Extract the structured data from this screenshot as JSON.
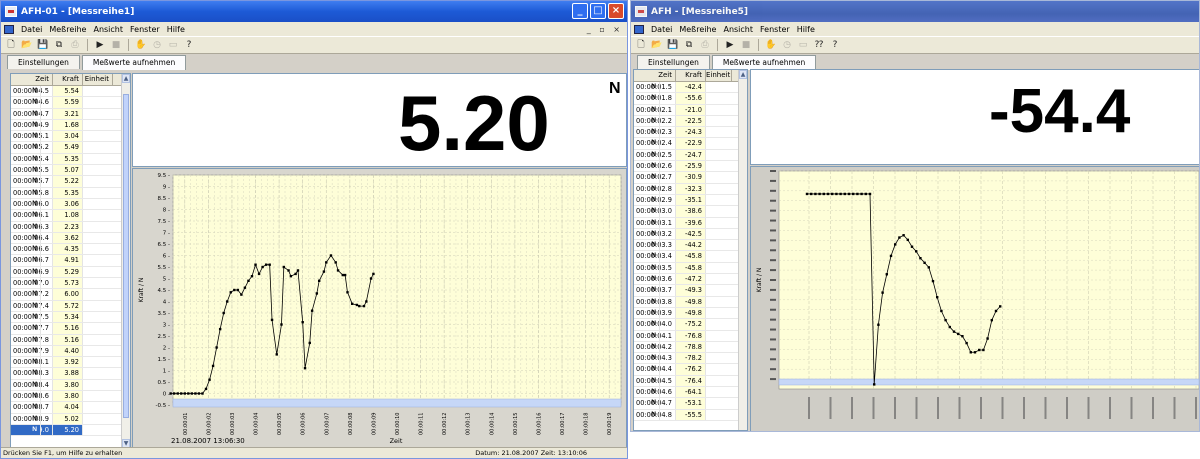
{
  "window_a": {
    "title": "AFH-01 - [Messreihe1]",
    "menu": [
      "Datei",
      "Meßreihe",
      "Ansicht",
      "Fenster",
      "Hilfe"
    ],
    "mdi_controls": "_ ▫ ×",
    "tabs": [
      "Einstellungen",
      "Meßwerte aufnehmen"
    ],
    "active_tab": 1,
    "columns": [
      "Zeit",
      "Kraft",
      "Einheit"
    ],
    "rows": [
      [
        "00:00:04.5",
        "5.54",
        "N"
      ],
      [
        "00:00:04.6",
        "5.59",
        "N"
      ],
      [
        "00:00:04.7",
        "3.21",
        "N"
      ],
      [
        "00:00:04.9",
        "1.68",
        "N"
      ],
      [
        "00:00:05.1",
        "3.04",
        "N"
      ],
      [
        "00:00:05.2",
        "5.49",
        "N"
      ],
      [
        "00:00:05.4",
        "5.35",
        "N"
      ],
      [
        "00:00:05.5",
        "5.07",
        "N"
      ],
      [
        "00:00:05.7",
        "5.22",
        "N"
      ],
      [
        "00:00:05.8",
        "5.35",
        "N"
      ],
      [
        "00:00:06.0",
        "3.06",
        "N"
      ],
      [
        "00:00:06.1",
        "1.08",
        "N"
      ],
      [
        "00:00:06.3",
        "2.23",
        "N"
      ],
      [
        "00:00:06.4",
        "3.62",
        "N"
      ],
      [
        "00:00:06.6",
        "4.35",
        "N"
      ],
      [
        "00:00:06.7",
        "4.91",
        "N"
      ],
      [
        "00:00:06.9",
        "5.29",
        "N"
      ],
      [
        "00:00:07.0",
        "5.73",
        "N"
      ],
      [
        "00:00:07.2",
        "6.00",
        "N"
      ],
      [
        "00:00:07.4",
        "5.72",
        "N"
      ],
      [
        "00:00:07.5",
        "5.34",
        "N"
      ],
      [
        "00:00:07.7",
        "5.16",
        "N"
      ],
      [
        "00:00:07.8",
        "5.16",
        "N"
      ],
      [
        "00:00:07.9",
        "4.40",
        "N"
      ],
      [
        "00:00:08.1",
        "3.92",
        "N"
      ],
      [
        "00:00:08.3",
        "3.88",
        "N"
      ],
      [
        "00:00:08.4",
        "3.80",
        "N"
      ],
      [
        "00:00:08.6",
        "3.80",
        "N"
      ],
      [
        "00:00:08.7",
        "4.04",
        "N"
      ],
      [
        "00:00:08.9",
        "5.02",
        "N"
      ],
      [
        "00:00:09.0",
        "5.20",
        "N"
      ]
    ],
    "selected_row": 30,
    "big_value": "5.20",
    "unit": "N",
    "ylabel": "Kraft / N",
    "xlabel": "Zeit",
    "timestamp": "21.08.2007  13:06:30",
    "status_left": "Drücken Sie F1, um Hilfe zu erhalten",
    "status_right": "Datum: 21.08.2007   Zeit: 13:10:06"
  },
  "window_b": {
    "title": "AFH - [Messreihe5]",
    "menu": [
      "Datei",
      "Meßreihe",
      "Ansicht",
      "Fenster",
      "Hilfe"
    ],
    "tabs": [
      "Einstellungen",
      "Meßwerte aufnehmen"
    ],
    "columns": [
      "Zeit",
      "Kraft",
      "Einheit"
    ],
    "rows": [
      [
        "00:00:01.5",
        "-42.4",
        "N"
      ],
      [
        "00:00:01.8",
        "-55.6",
        "N"
      ],
      [
        "00:00:02.1",
        "-21.0",
        "N"
      ],
      [
        "00:00:02.2",
        "-22.5",
        "N"
      ],
      [
        "00:00:02.3",
        "-24.3",
        "N"
      ],
      [
        "00:00:02.4",
        "-22.9",
        "N"
      ],
      [
        "00:00:02.5",
        "-24.7",
        "N"
      ],
      [
        "00:00:02.6",
        "-25.9",
        "N"
      ],
      [
        "00:00:02.7",
        "-30.9",
        "N"
      ],
      [
        "00:00:02.8",
        "-32.3",
        "N"
      ],
      [
        "00:00:02.9",
        "-35.1",
        "N"
      ],
      [
        "00:00:03.0",
        "-38.6",
        "N"
      ],
      [
        "00:00:03.1",
        "-39.6",
        "N"
      ],
      [
        "00:00:03.2",
        "-42.5",
        "N"
      ],
      [
        "00:00:03.3",
        "-44.2",
        "N"
      ],
      [
        "00:00:03.4",
        "-45.8",
        "N"
      ],
      [
        "00:00:03.5",
        "-45.8",
        "N"
      ],
      [
        "00:00:03.6",
        "-47.2",
        "N"
      ],
      [
        "00:00:03.7",
        "-49.3",
        "N"
      ],
      [
        "00:00:03.8",
        "-49.8",
        "N"
      ],
      [
        "00:00:03.9",
        "-49.8",
        "N"
      ],
      [
        "00:00:04.0",
        "-75.2",
        "N"
      ],
      [
        "00:00:04.1",
        "-76.8",
        "N"
      ],
      [
        "00:00:04.2",
        "-78.8",
        "N"
      ],
      [
        "00:00:04.3",
        "-78.2",
        "N"
      ],
      [
        "00:00:04.4",
        "-76.2",
        "N"
      ],
      [
        "00:00:04.5",
        "-76.4",
        "N"
      ],
      [
        "00:00:04.6",
        "-64.1",
        "N"
      ],
      [
        "00:00:04.7",
        "-53.1",
        "N"
      ],
      [
        "00:00:04.8",
        "-55.5",
        "N"
      ]
    ],
    "big_value": "-54.4",
    "ylabel": "Kraft / N"
  },
  "chart_data": [
    {
      "type": "line",
      "ylabel": "Kraft / N",
      "xlabel": "Zeit",
      "ylim": [
        -0.5,
        9.5
      ],
      "yticks": [
        "-0.5",
        "0",
        "0.5",
        "1",
        "1.5",
        "2",
        "2.5",
        "3",
        "3.5",
        "4",
        "4.5",
        "5",
        "5.5",
        "6",
        "6.5",
        "7",
        "7.5",
        "8",
        "8.5",
        "9",
        "9.5"
      ],
      "xticks": [
        "00:00:01",
        "00:00:02",
        "00:00:03",
        "00:00:04",
        "00:00:05",
        "00:00:06",
        "00:00:07",
        "00:00:08",
        "00:00:09",
        "00:00:10",
        "00:00:11",
        "00:00:12",
        "00:00:13",
        "00:00:14",
        "00:00:15",
        "00:00:16",
        "00:00:17",
        "00:00:18",
        "00:00:19"
      ],
      "xlim": [
        0.5,
        19.5
      ],
      "series": [
        {
          "x": [
            0.4,
            0.55,
            0.7,
            0.85,
            1.0,
            1.15,
            1.3,
            1.45,
            1.6,
            1.75,
            1.9,
            2.05,
            2.2,
            2.35,
            2.5,
            2.65,
            2.8,
            2.95,
            3.1,
            3.25,
            3.4,
            3.55,
            3.7,
            3.85,
            4.0,
            4.15,
            4.3,
            4.45,
            4.6,
            4.7,
            4.9,
            5.1,
            5.2,
            5.4,
            5.5,
            5.7,
            5.8,
            6.0,
            6.1,
            6.3,
            6.4,
            6.6,
            6.7,
            6.9,
            7.0,
            7.2,
            7.4,
            7.5,
            7.7,
            7.8,
            7.9,
            8.1,
            8.3,
            8.4,
            8.6,
            8.7,
            8.9,
            9.0
          ],
          "y": [
            0,
            0,
            0,
            0,
            0,
            0,
            0,
            0,
            0,
            0,
            0.2,
            0.6,
            1.2,
            2.0,
            2.8,
            3.5,
            4.0,
            4.4,
            4.5,
            4.5,
            4.3,
            4.6,
            4.9,
            5.1,
            5.6,
            5.2,
            5.5,
            5.6,
            5.6,
            3.2,
            1.7,
            3.0,
            5.5,
            5.35,
            5.1,
            5.2,
            5.35,
            3.1,
            1.1,
            2.2,
            3.6,
            4.35,
            4.9,
            5.3,
            5.7,
            6.0,
            5.7,
            5.35,
            5.15,
            5.15,
            4.4,
            3.9,
            3.85,
            3.8,
            3.8,
            4.0,
            5.0,
            5.2
          ]
        }
      ]
    },
    {
      "type": "line",
      "ylabel": "Kraft / N",
      "ylim": [
        -90,
        5
      ],
      "series": [
        {
          "y": [
            -5,
            -5,
            -5,
            -5,
            -5,
            -5,
            -5,
            -5,
            -5,
            -5,
            -5,
            -5,
            -5,
            -5,
            -5,
            -5,
            -88,
            -62,
            -48,
            -40,
            -32,
            -27,
            -24,
            -23,
            -25,
            -28,
            -30,
            -33,
            -35,
            -37,
            -43,
            -50,
            -56,
            -60,
            -63,
            -65,
            -66,
            -67,
            -70,
            -74,
            -74,
            -73,
            -73,
            -68,
            -60,
            -56,
            -54
          ]
        }
      ]
    }
  ]
}
